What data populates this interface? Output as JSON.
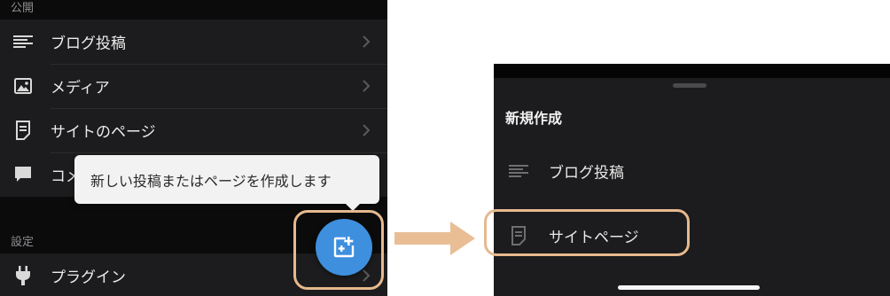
{
  "left_screen": {
    "sections": [
      {
        "header": "公開"
      },
      {
        "header": "設定"
      }
    ],
    "menu_items": [
      {
        "label": "ブログ投稿",
        "icon": "posts-icon"
      },
      {
        "label": "メディア",
        "icon": "media-image-icon"
      },
      {
        "label": "サイトのページ",
        "icon": "page-icon"
      },
      {
        "label": "コメ",
        "icon": "comment-icon"
      },
      {
        "label": "プラグイン",
        "icon": "plugin-icon"
      }
    ],
    "tooltip": "新しい投稿またはページを作成します",
    "fab": {
      "icon": "create-new-icon",
      "color": "#3e8fde"
    }
  },
  "right_screen": {
    "sheet_title": "新規作成",
    "options": [
      {
        "label": "ブログ投稿",
        "icon": "posts-icon"
      },
      {
        "label": "サイトページ",
        "icon": "page-icon"
      }
    ]
  },
  "colors": {
    "highlight": "#e6b98e",
    "arrow": "#e9be95",
    "accent": "#3e8fde"
  }
}
